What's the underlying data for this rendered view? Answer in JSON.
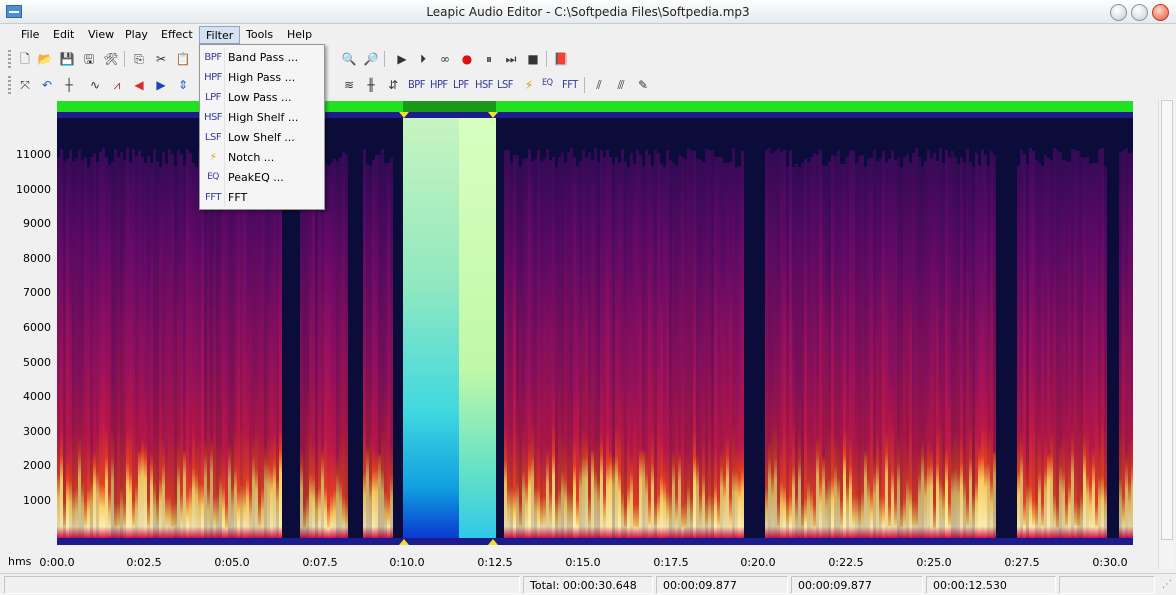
{
  "window": {
    "title": "Leapic Audio Editor - C:\\Softpedia Files\\Softpedia.mp3"
  },
  "menu": [
    {
      "label": "File"
    },
    {
      "label": "Edit"
    },
    {
      "label": "View"
    },
    {
      "label": "Play"
    },
    {
      "label": "Effect"
    },
    {
      "label": "Filter"
    },
    {
      "label": "Tools"
    },
    {
      "label": "Help"
    }
  ],
  "filter_menu": [
    {
      "icon": "BPF",
      "label": "Band Pass ..."
    },
    {
      "icon": "HPF",
      "label": "High Pass ..."
    },
    {
      "icon": "LPF",
      "label": "Low Pass ..."
    },
    {
      "icon": "HSF",
      "label": "High Shelf ..."
    },
    {
      "icon": "LSF",
      "label": "Low Shelf ..."
    },
    {
      "icon": "",
      "label": "Notch ..."
    },
    {
      "icon": "EQ",
      "label": "PeakEQ ..."
    },
    {
      "icon": "FFT",
      "label": "FFT"
    }
  ],
  "toolbar2_text_buttons": [
    {
      "label": "BPF"
    },
    {
      "label": "HPF"
    },
    {
      "label": "LPF"
    },
    {
      "label": "HSF"
    },
    {
      "label": "LSF"
    },
    {
      "label": "EQ"
    },
    {
      "label": "FFT"
    }
  ],
  "frequency_axis": [
    "11000",
    "10000",
    "9000",
    "8000",
    "7000",
    "6000",
    "5000",
    "4000",
    "3000",
    "2000",
    "1000"
  ],
  "time_axis": {
    "unit_label": "hms",
    "ticks": [
      "0:00.0",
      "0:02.5",
      "0:05.0",
      "0:07.5",
      "0:10.0",
      "0:12.5",
      "0:15.0",
      "0:17.5",
      "0:20.0",
      "0:22.5",
      "0:25.0",
      "0:27.5",
      "0:30.0"
    ]
  },
  "status": {
    "total": "Total: 00:00:30.648",
    "sel_start": "00:00:09.877",
    "cursor": "00:00:09.877",
    "sel_end": "00:00:12.530"
  },
  "colors": {
    "spectrogram_bg": "#0c0c3a",
    "selection_green": "#22e022",
    "marker_yellow": "#f4e020"
  }
}
